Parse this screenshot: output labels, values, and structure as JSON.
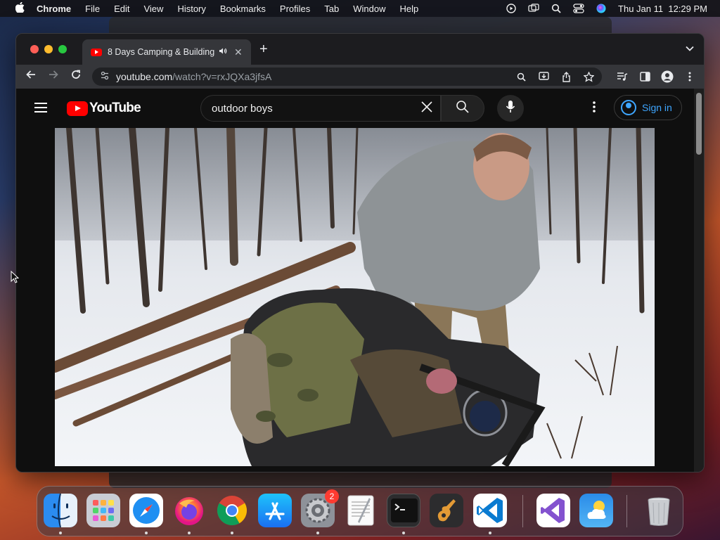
{
  "menubar": {
    "app": "Chrome",
    "items": [
      "File",
      "Edit",
      "View",
      "History",
      "Bookmarks",
      "Profiles",
      "Tab",
      "Window",
      "Help"
    ],
    "clock": "Thu Jan 11  12:29 PM",
    "status_icons": [
      "play-circle-icon",
      "screen-mirror-icon",
      "spotlight-search-icon",
      "control-center-icon",
      "siri-icon"
    ]
  },
  "browser": {
    "tab": {
      "title": "8 Days Camping & Building",
      "favicon": "youtube-favicon-icon"
    },
    "new_tab_label": "+",
    "address": {
      "host": "youtube.com",
      "path": "/watch?v=rxJQXa3jfsA"
    }
  },
  "youtube": {
    "logo_text": "YouTube",
    "search": {
      "value": "outdoor boys",
      "placeholder": "Search"
    },
    "signin_label": "Sign in",
    "colors": {
      "brand_red": "#ff0000",
      "link_blue": "#3ea6ff"
    }
  },
  "dock": {
    "apps": [
      "Finder",
      "Launchpad",
      "Safari",
      "Firefox",
      "Google Chrome",
      "App Store",
      "System Settings",
      "TextEdit",
      "Terminal",
      "GarageBand",
      "Visual Studio Code",
      "Visual Studio",
      "Weather",
      "Trash"
    ],
    "system_settings_badge": "2"
  }
}
